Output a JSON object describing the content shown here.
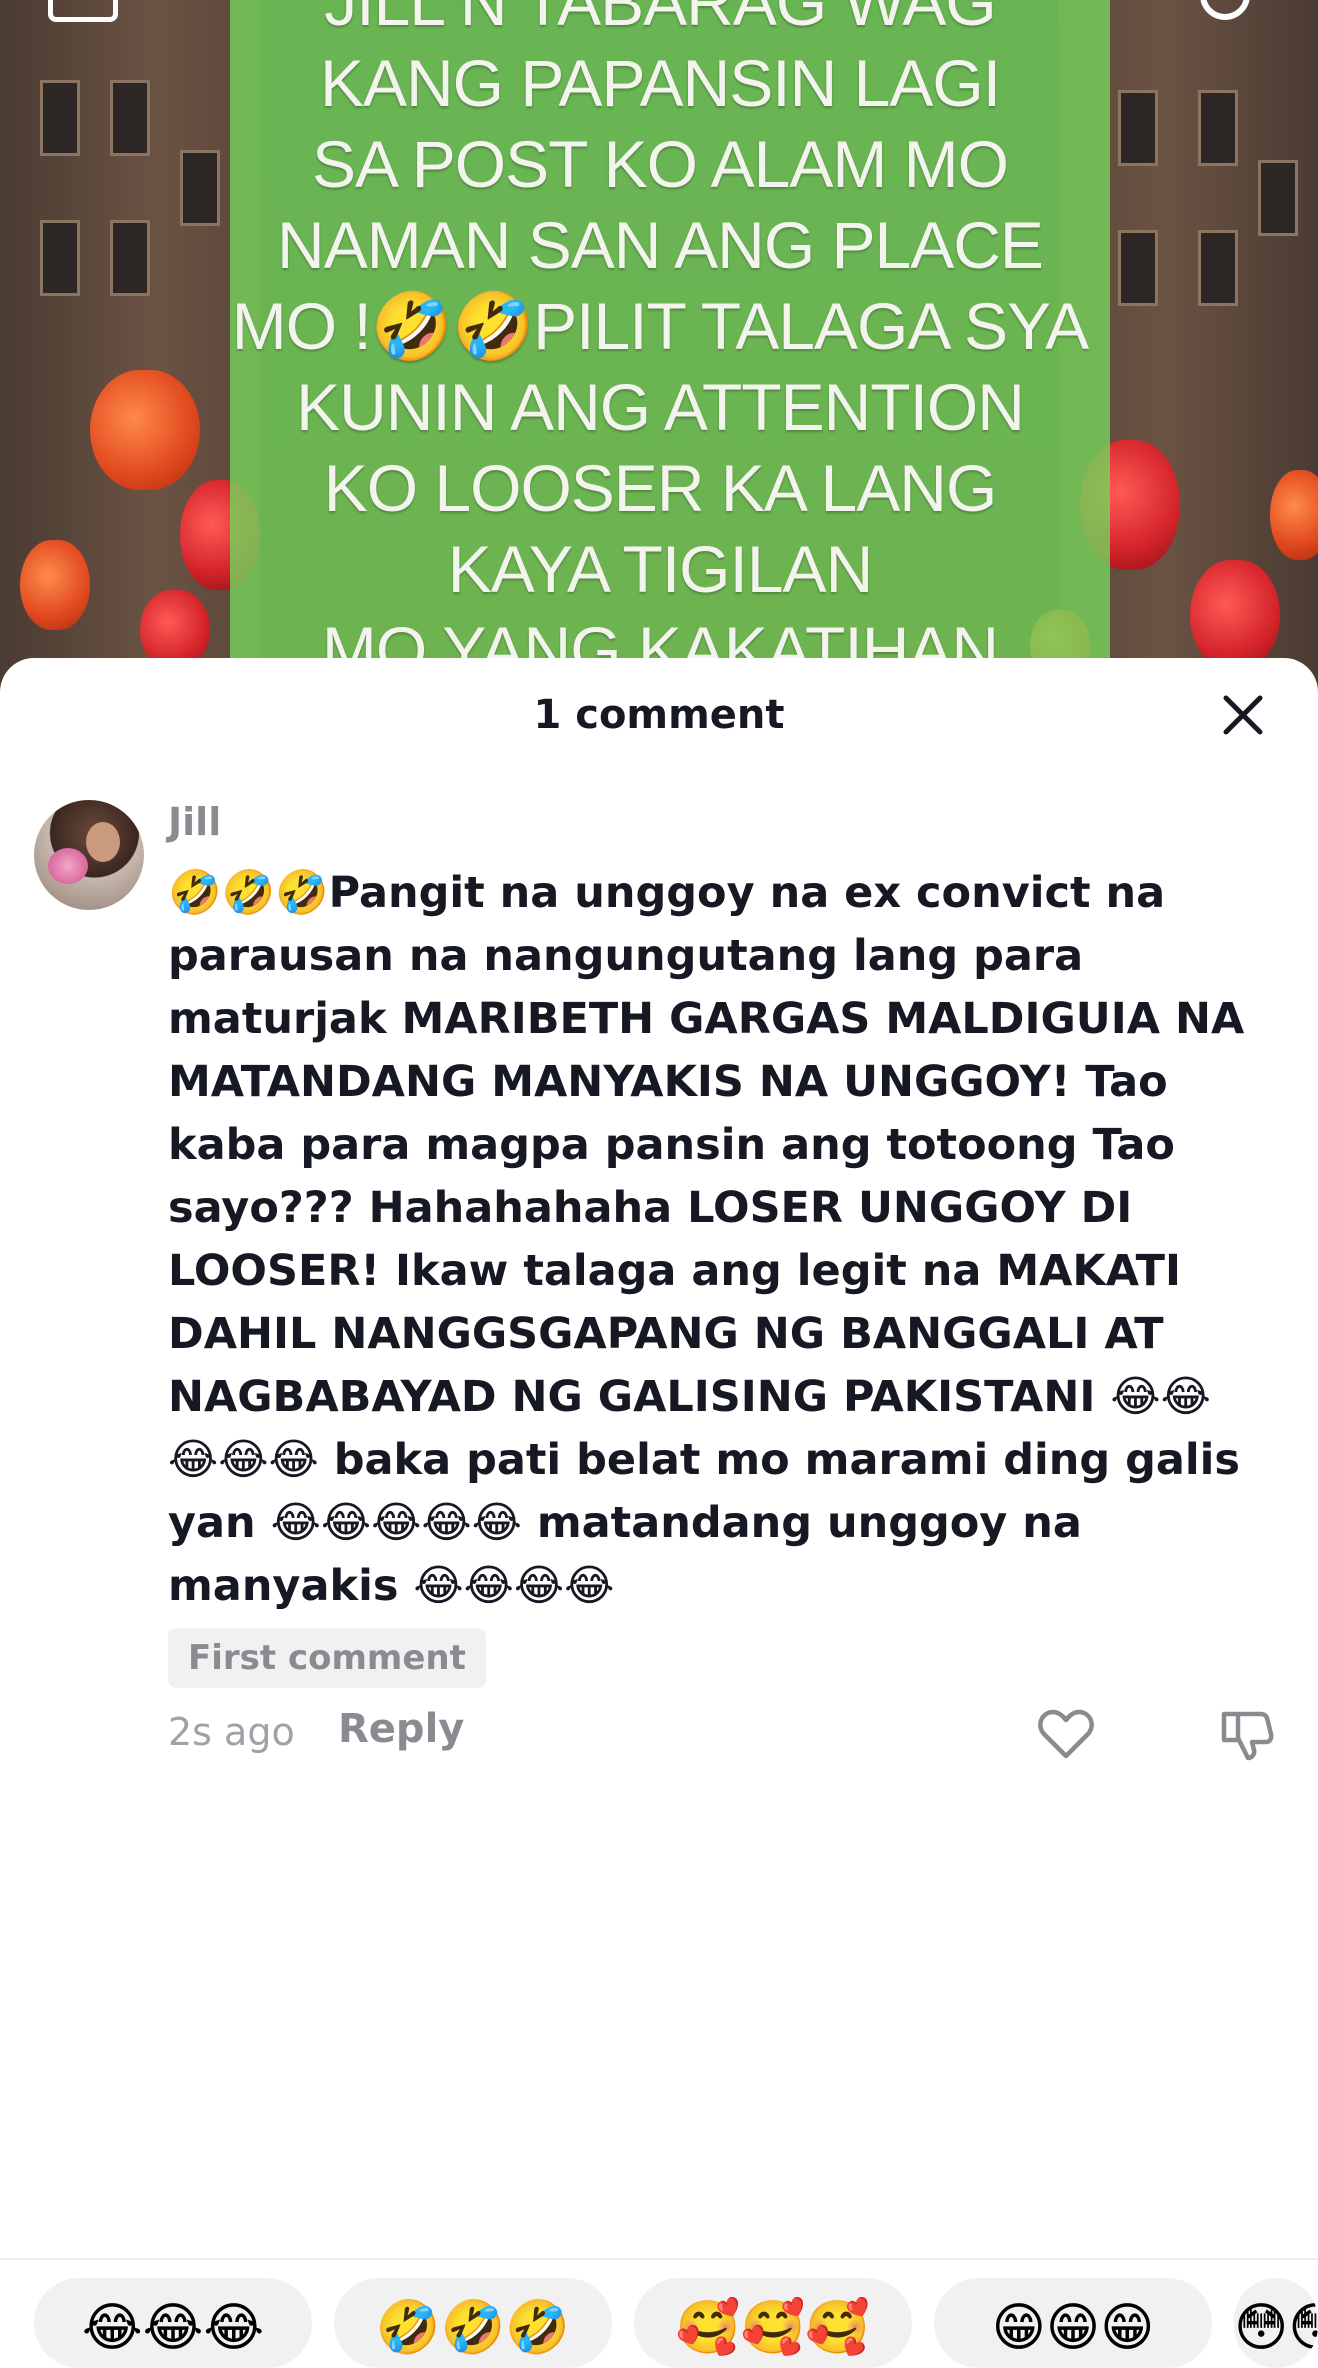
{
  "video": {
    "overlay_lines": [
      "JILL N TABARAG WAG",
      "KANG PAPANSIN LAGI",
      "SA POST KO  ALAM MO",
      "NAMAN SAN ANG PLACE",
      "MO !🤣🤣PILIT TALAGA SYA",
      "KUNIN ANG ATTENTION",
      "KO  LOOSER KA LANG",
      "KAYA TIGILAN",
      "MO YANG KAKATIHAN"
    ]
  },
  "sheet": {
    "title": "1 comment"
  },
  "comment": {
    "username": "Jill",
    "text": "🤣🤣🤣Pangit na unggoy na ex convict na parausan na nangungutang lang para maturjak MARIBETH GARGAS MALDIGUIA NA MATANDANG MANYAKIS NA UNGGOY! Tao kaba para magpa pansin ang totoong Tao sayo??? Hahahahaha LOSER UNGGOY DI LOOSER! Ikaw talaga ang legit na MAKATI DAHIL NANGGSGAPANG NG BANGGALI AT NAGBABAYAD NG GALISING PAKISTANI 😂😂😂😂😂 baka pati belat mo marami ding galis yan 😂😂😂😂😂 matandang unggoy na manyakis 😂😂😂😂",
    "badge": "First comment",
    "time": "2s ago",
    "reply_label": "Reply"
  },
  "icons": {
    "live": "live-icon",
    "search": "search-icon",
    "close": "close-icon",
    "like": "heart-icon",
    "dislike": "thumbs-down-icon"
  },
  "emoji_bar": [
    "😂😂😂",
    "🤣🤣🤣",
    "🥰🥰🥰",
    "😁😁😁",
    "😳😳😳"
  ],
  "colors": {
    "text_primary": "#161823",
    "text_secondary": "#8a8b91",
    "overlay_green": "#76d25a"
  }
}
